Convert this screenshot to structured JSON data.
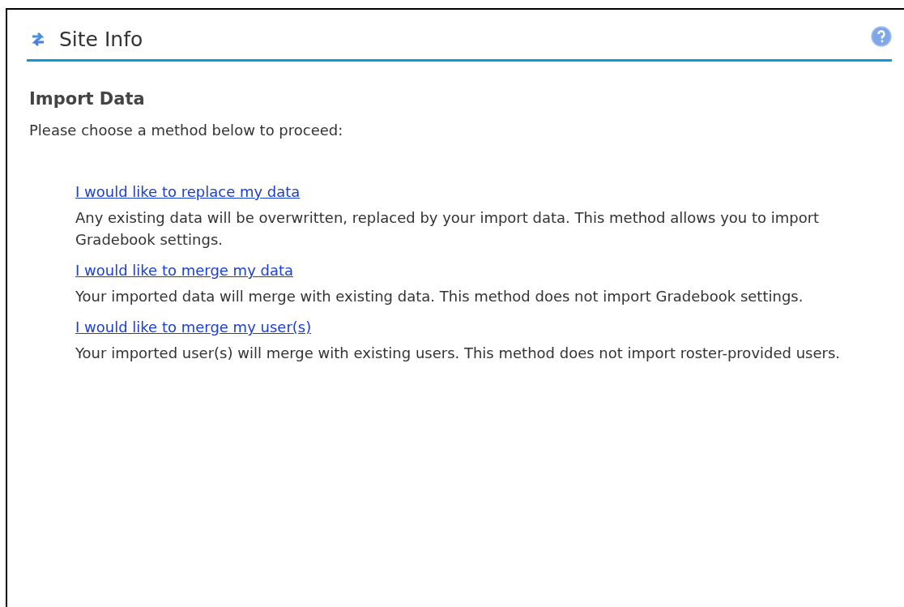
{
  "header": {
    "title": "Site Info"
  },
  "section": {
    "title": "Import Data",
    "intro": "Please choose a method below to proceed:"
  },
  "methods": [
    {
      "link": "I would like to replace my data",
      "description": "Any existing data will be overwritten, replaced by your import data. This method allows you to import Gradebook settings."
    },
    {
      "link": "I would like to merge my data",
      "description": "Your imported data will merge with existing data. This method does not import Gradebook settings."
    },
    {
      "link": "I would like to merge my user(s)",
      "description": "Your imported user(s) will merge with existing users. This method does not import roster-provided users."
    }
  ]
}
